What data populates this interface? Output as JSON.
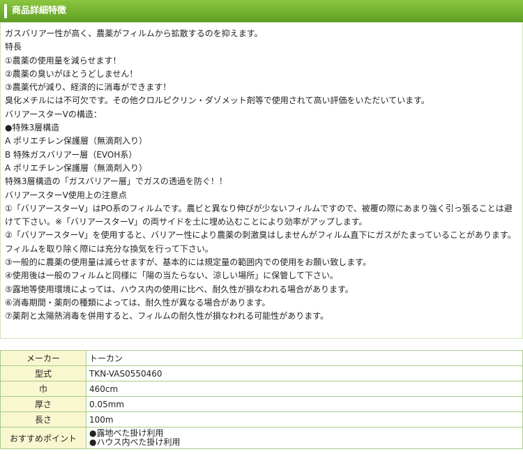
{
  "section_title": "商品詳細特徴",
  "description_lines": [
    "ガスバリアー性が高く、農薬がフィルムから拡散するのを抑えます。",
    "特長",
    "①農薬の使用量を減らせます！",
    "②農薬の臭いがほとうどしません！",
    "③農薬代が減り、経済的に消毒ができます！",
    "臭化メチルには不可欠です。その他クロルピクリン・ダゾメット剤等で使用されて高い評価をいただいています。",
    "バリアースターVの構造：",
    "●特殊3層構造",
    "A ポリエチレン保護層（無滴剤入り）",
    "B 特殊ガスバリアー層（EVOH系）",
    "A ポリエチレン保護層（無滴剤入り）",
    "特殊3層構造の「ガスバリアー層」でガスの透過を防ぐ！！",
    "バリアースターV使用上の注意点",
    "①「バリアースターV」はPO系のフィルムです。農ビと異なり伸びが少ないフィルムですので、被覆の際にあまり強く引っ張ることは避けて下さい。※「バリアースターV」の両サイドを土に埋め込むことにより効率がアップします。",
    "②「バリアースターV」を使用すると、バリアー性により農薬の刺激臭はしませんがフィルム直下にガスがたまっていることがあります。",
    "フィルムを取り除く際には充分な換気を行って下さい。",
    "③一般的に農薬の使用量は減らせますが、基本的には規定量の範囲内での使用をお願い致します。",
    "④使用後は一般のフィルムと同様に「陽の当たらない、涼しい場所」に保管して下さい。",
    "⑤露地等使用環境によっては、ハウス内の使用に比べ、耐久性が損なわれる場合があります。",
    "⑥消毒期間・薬剤の種類によっては、耐久性が異なる場合があります。",
    "⑦薬剤と太陽熱消毒を併用すると、フィルムの耐久性が損なわれる可能性があります。"
  ],
  "spec_table": [
    {
      "label": "メーカー",
      "value": "トーカン"
    },
    {
      "label": "型式",
      "value": "TKN-VAS0550460"
    },
    {
      "label": "巾",
      "value": "460cm"
    },
    {
      "label": "厚さ",
      "value": "0.05mm"
    },
    {
      "label": "長さ",
      "value": "100m"
    }
  ],
  "recommend": {
    "label": "おすすめポイント",
    "items": [
      "●露地べた掛け利用",
      "●ハウス内べた掛け利用"
    ]
  },
  "colors": {
    "header_green": "#6aaa2a",
    "label_cell_bg": "#f9f7cf",
    "border_green": "#a9c98a"
  }
}
